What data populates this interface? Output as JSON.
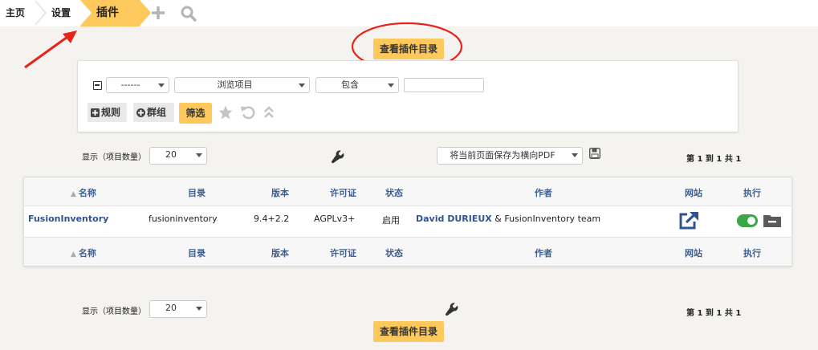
{
  "breadcrumb": {
    "home": "主页",
    "settings": "设置",
    "current": "插件"
  },
  "header_icons": [
    "plus-icon",
    "search-icon"
  ],
  "catalog_button": "查看插件目录",
  "search": {
    "field_value": "------",
    "criteria_value": "浏览项目",
    "operator_value": "包含",
    "term_value": "",
    "rule_button": "规则",
    "group_button": "群组",
    "filter_button": "筛选"
  },
  "list_controls": {
    "display_label": "显示（项目数量）",
    "display_count": "20",
    "export_option": "将当前页面保存为横向PDF",
    "pagination": "第 1 到 1 共 1"
  },
  "table": {
    "headers": {
      "name": "名称",
      "directory": "目录",
      "version": "版本",
      "license": "许可证",
      "status": "状态",
      "author": "作者",
      "website": "网站",
      "action": "执行"
    },
    "rows": [
      {
        "name": "FusionInventory",
        "directory": "fusioninventory",
        "version": "9.4+2.2",
        "license": "AGPLv3+",
        "status": "启用",
        "author_link": "David DURIEUX",
        "author_rest": "& FusionInventory team",
        "enabled": true
      }
    ]
  },
  "colors": {
    "accent": "#fec95c",
    "link": "#2f5490",
    "toggle_on": "#3aa845",
    "annotation": "#e8231a"
  }
}
